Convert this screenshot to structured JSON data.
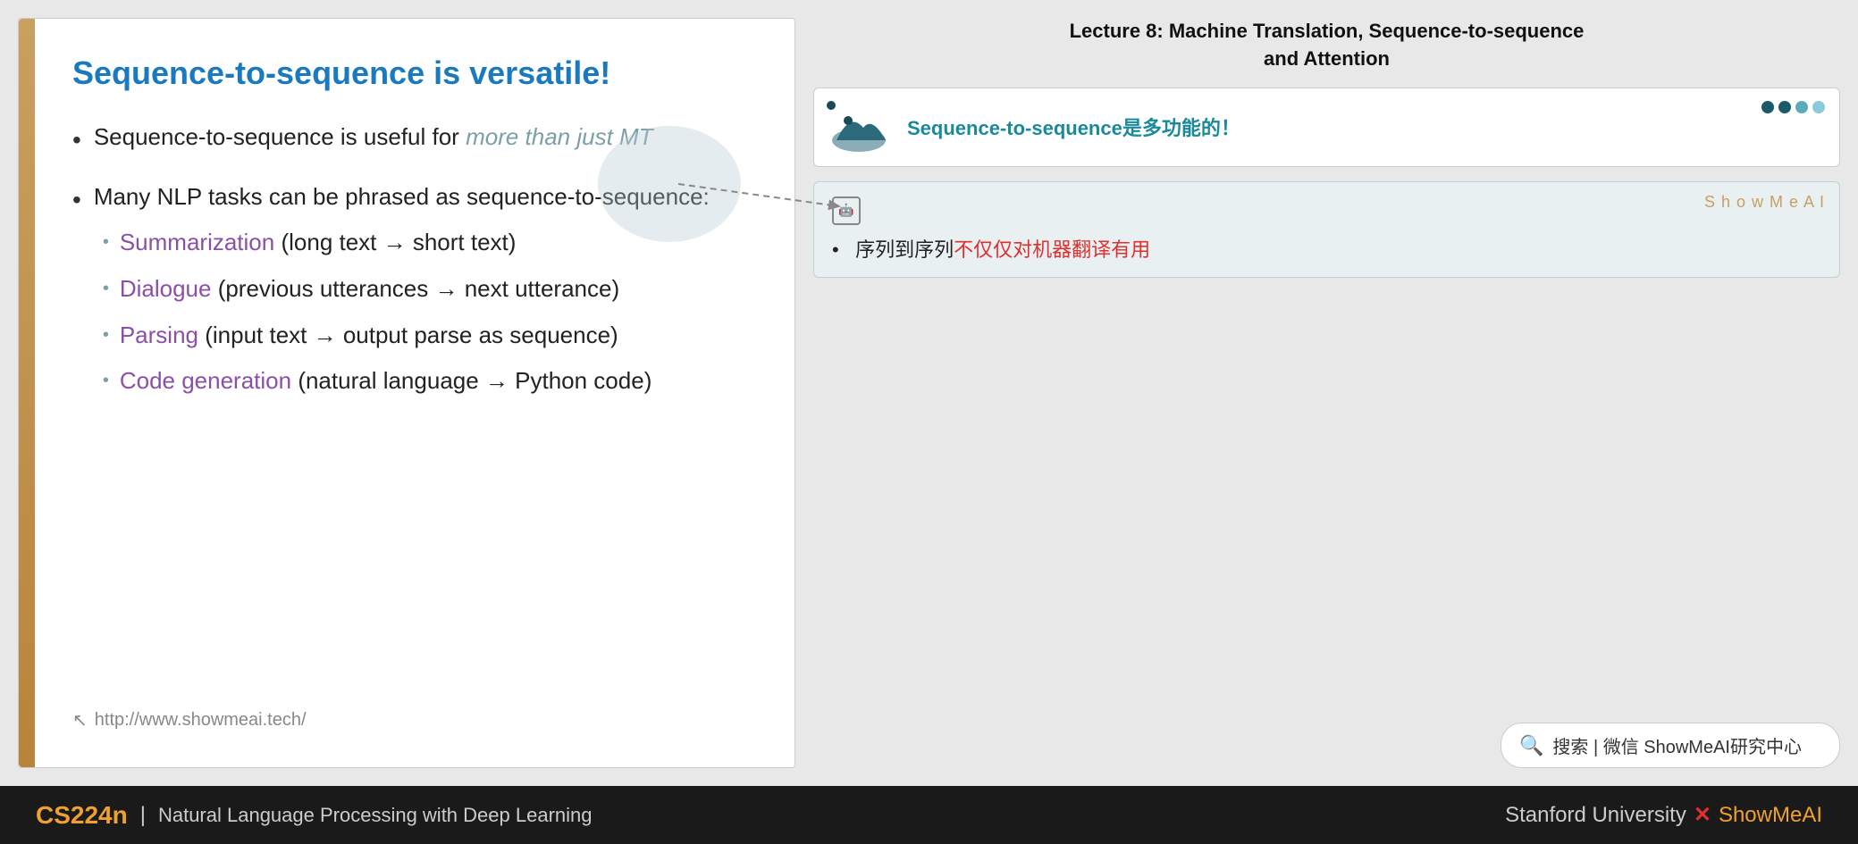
{
  "slide": {
    "title": "Sequence-to-sequence is versatile!",
    "left_bar_color": "#c8903a",
    "bullet1": {
      "text_before": "Sequence-to-sequence is useful for ",
      "text_italic": "more than just MT"
    },
    "bullet2": {
      "text": "Many NLP tasks can be phrased as sequence-to-sequence:",
      "sub_items": [
        {
          "label": "Summarization",
          "rest": " (long text → short text)"
        },
        {
          "label": "Dialogue",
          "rest": " (previous utterances → next utterance)"
        },
        {
          "label": "Parsing",
          "rest": " (input text → output parse as sequence)"
        },
        {
          "label": "Code generation",
          "rest": " (natural language → Python code)"
        }
      ]
    },
    "footer_url": "http://www.showmeai.tech/"
  },
  "right_panel": {
    "lecture_header_line1": "Lecture 8:  Machine Translation, Sequence-to-sequence",
    "lecture_header_line2": "and Attention",
    "mini_slide_title": "Sequence-to-sequence是多功能的！",
    "showmeai_card": {
      "label": "S h o w M e A I",
      "ai_icon": "AI",
      "bullet_before": "序列到序列",
      "bullet_red": "不仅仅对机器翻译有用",
      "bullet_prefix": "•"
    },
    "search_bar": {
      "icon": "🔍",
      "text": "搜索 | 微信 ShowMeAI研究中心"
    }
  },
  "bottom_bar": {
    "cs224n": "CS224n",
    "divider": "|",
    "course_title": "Natural Language Processing with Deep Learning",
    "bottom_right_text": "Stanford University",
    "x_mark": "✕",
    "showmeai": "ShowMeAI"
  }
}
